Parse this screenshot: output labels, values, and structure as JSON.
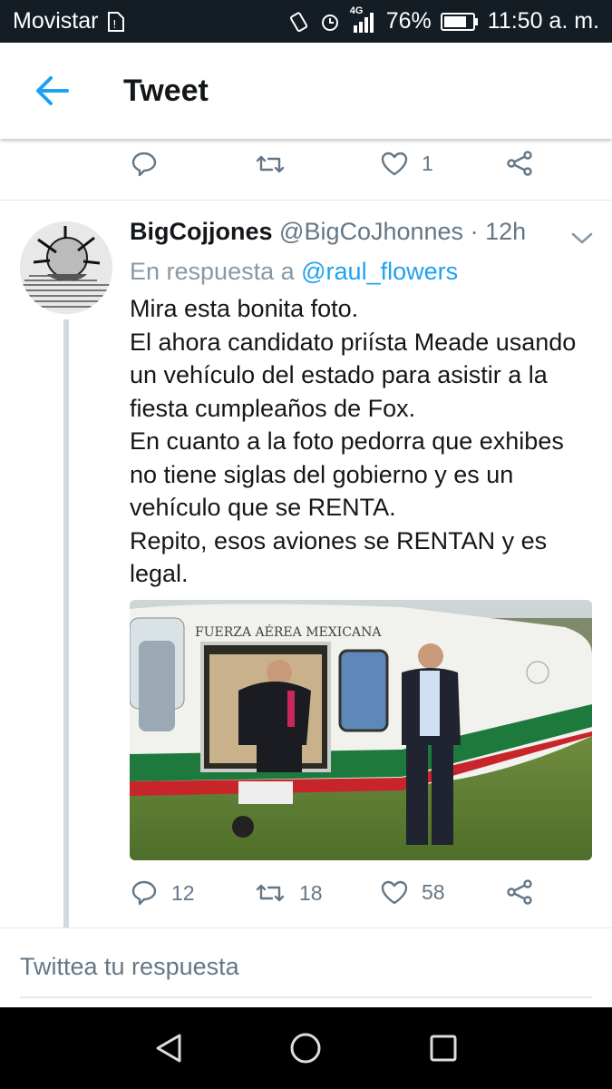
{
  "status_bar": {
    "carrier": "Movistar",
    "network": "4G",
    "battery": "76%",
    "time": "11:50 a. m."
  },
  "app_bar": {
    "title": "Tweet"
  },
  "prev_tweet_actions": {
    "likes": "1"
  },
  "tweet": {
    "display_name": "BigCojjones",
    "handle": "@BigCoJhonnes",
    "separator": "·",
    "time": "12h",
    "reply_prefix": "En respuesta a",
    "reply_to": "@raul_flowers",
    "lines": [
      "Mira esta bonita foto.",
      "El ahora candidato priísta Meade usando",
      "un vehículo del estado para asistir a la",
      "fiesta cumpleaños de Fox.",
      "En cuanto a la foto pedorra que exhibes",
      "no tiene siglas del gobierno y es un",
      "vehículo que se RENTA.",
      "Repito, esos aviones se RENTAN y es",
      "legal."
    ],
    "photo_text": "FUERZA AÉREA MEXICANA",
    "replies": "12",
    "retweets": "18",
    "likes": "58"
  },
  "compose": {
    "placeholder": "Twittea tu respuesta"
  },
  "colors": {
    "accent": "#1da1f2",
    "muted": "#657786",
    "statusbar": "#141c24"
  }
}
